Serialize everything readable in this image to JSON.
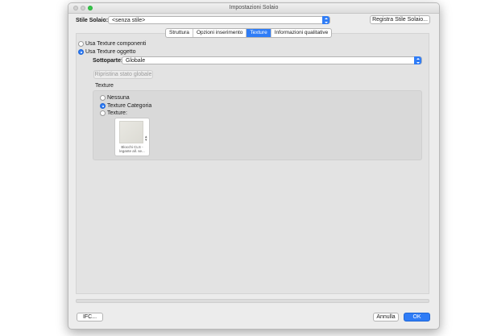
{
  "window": {
    "title": "Impostazioni Solaio"
  },
  "header": {
    "style_label": "Stile Solaio:",
    "style_value": "<senza stile>",
    "register_button": "Registra Stile Solaio..."
  },
  "tabs": [
    {
      "label": "Struttura",
      "active": false
    },
    {
      "label": "Opzioni inserimento",
      "active": false
    },
    {
      "label": "Texture",
      "active": true
    },
    {
      "label": "Informazioni qualitative",
      "active": false
    }
  ],
  "texture_mode": {
    "option_components": "Usa Texture componenti",
    "option_object": "Usa Texture oggetto",
    "selected": "object"
  },
  "subpart": {
    "label": "Sottoparte:",
    "value": "Globale"
  },
  "restore_button": "Ripristina stato globale",
  "texture_group": {
    "title": "Texture",
    "option_none": "Nessuna",
    "option_category": "Texture Categoria",
    "option_texture": "Texture:",
    "selected": "category",
    "thumbnail_caption": "Blocchi CLS - legante all. se..."
  },
  "footer": {
    "ifc_button": "IFC...",
    "cancel_button": "Annulla",
    "ok_button": "OK"
  },
  "colors": {
    "accent": "#2f7cf6",
    "window_bg": "#ececec",
    "panel_bg": "#e3e3e3"
  }
}
